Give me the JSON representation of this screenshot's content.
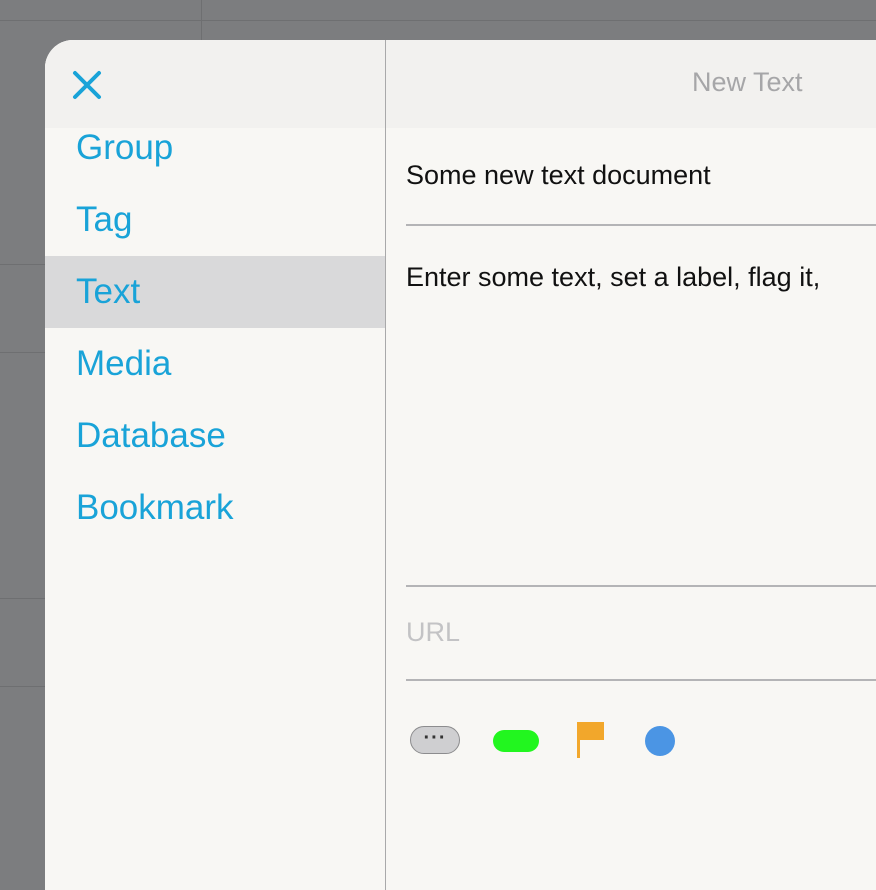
{
  "header": {
    "close_icon": "close-icon",
    "title": "New Text"
  },
  "menu": {
    "items": [
      {
        "label": "Group"
      },
      {
        "label": "Tag"
      },
      {
        "label": "Text",
        "selected": true
      },
      {
        "label": "Media"
      },
      {
        "label": "Database"
      },
      {
        "label": "Bookmark"
      }
    ]
  },
  "form": {
    "title_value": "Some new text document",
    "body_value": "Enter some text, set a label, flag it,",
    "url_placeholder": "URL"
  },
  "controls": {
    "more_icon": "ellipsis-icon",
    "more_text": "···",
    "label_color": "#22f61f",
    "flag_icon": "flag-icon",
    "flag_color": "#f2a72b",
    "dot_color": "#4b95e4"
  },
  "colors": {
    "accent": "#19a3d8",
    "selected_bg": "#d9d9da"
  }
}
